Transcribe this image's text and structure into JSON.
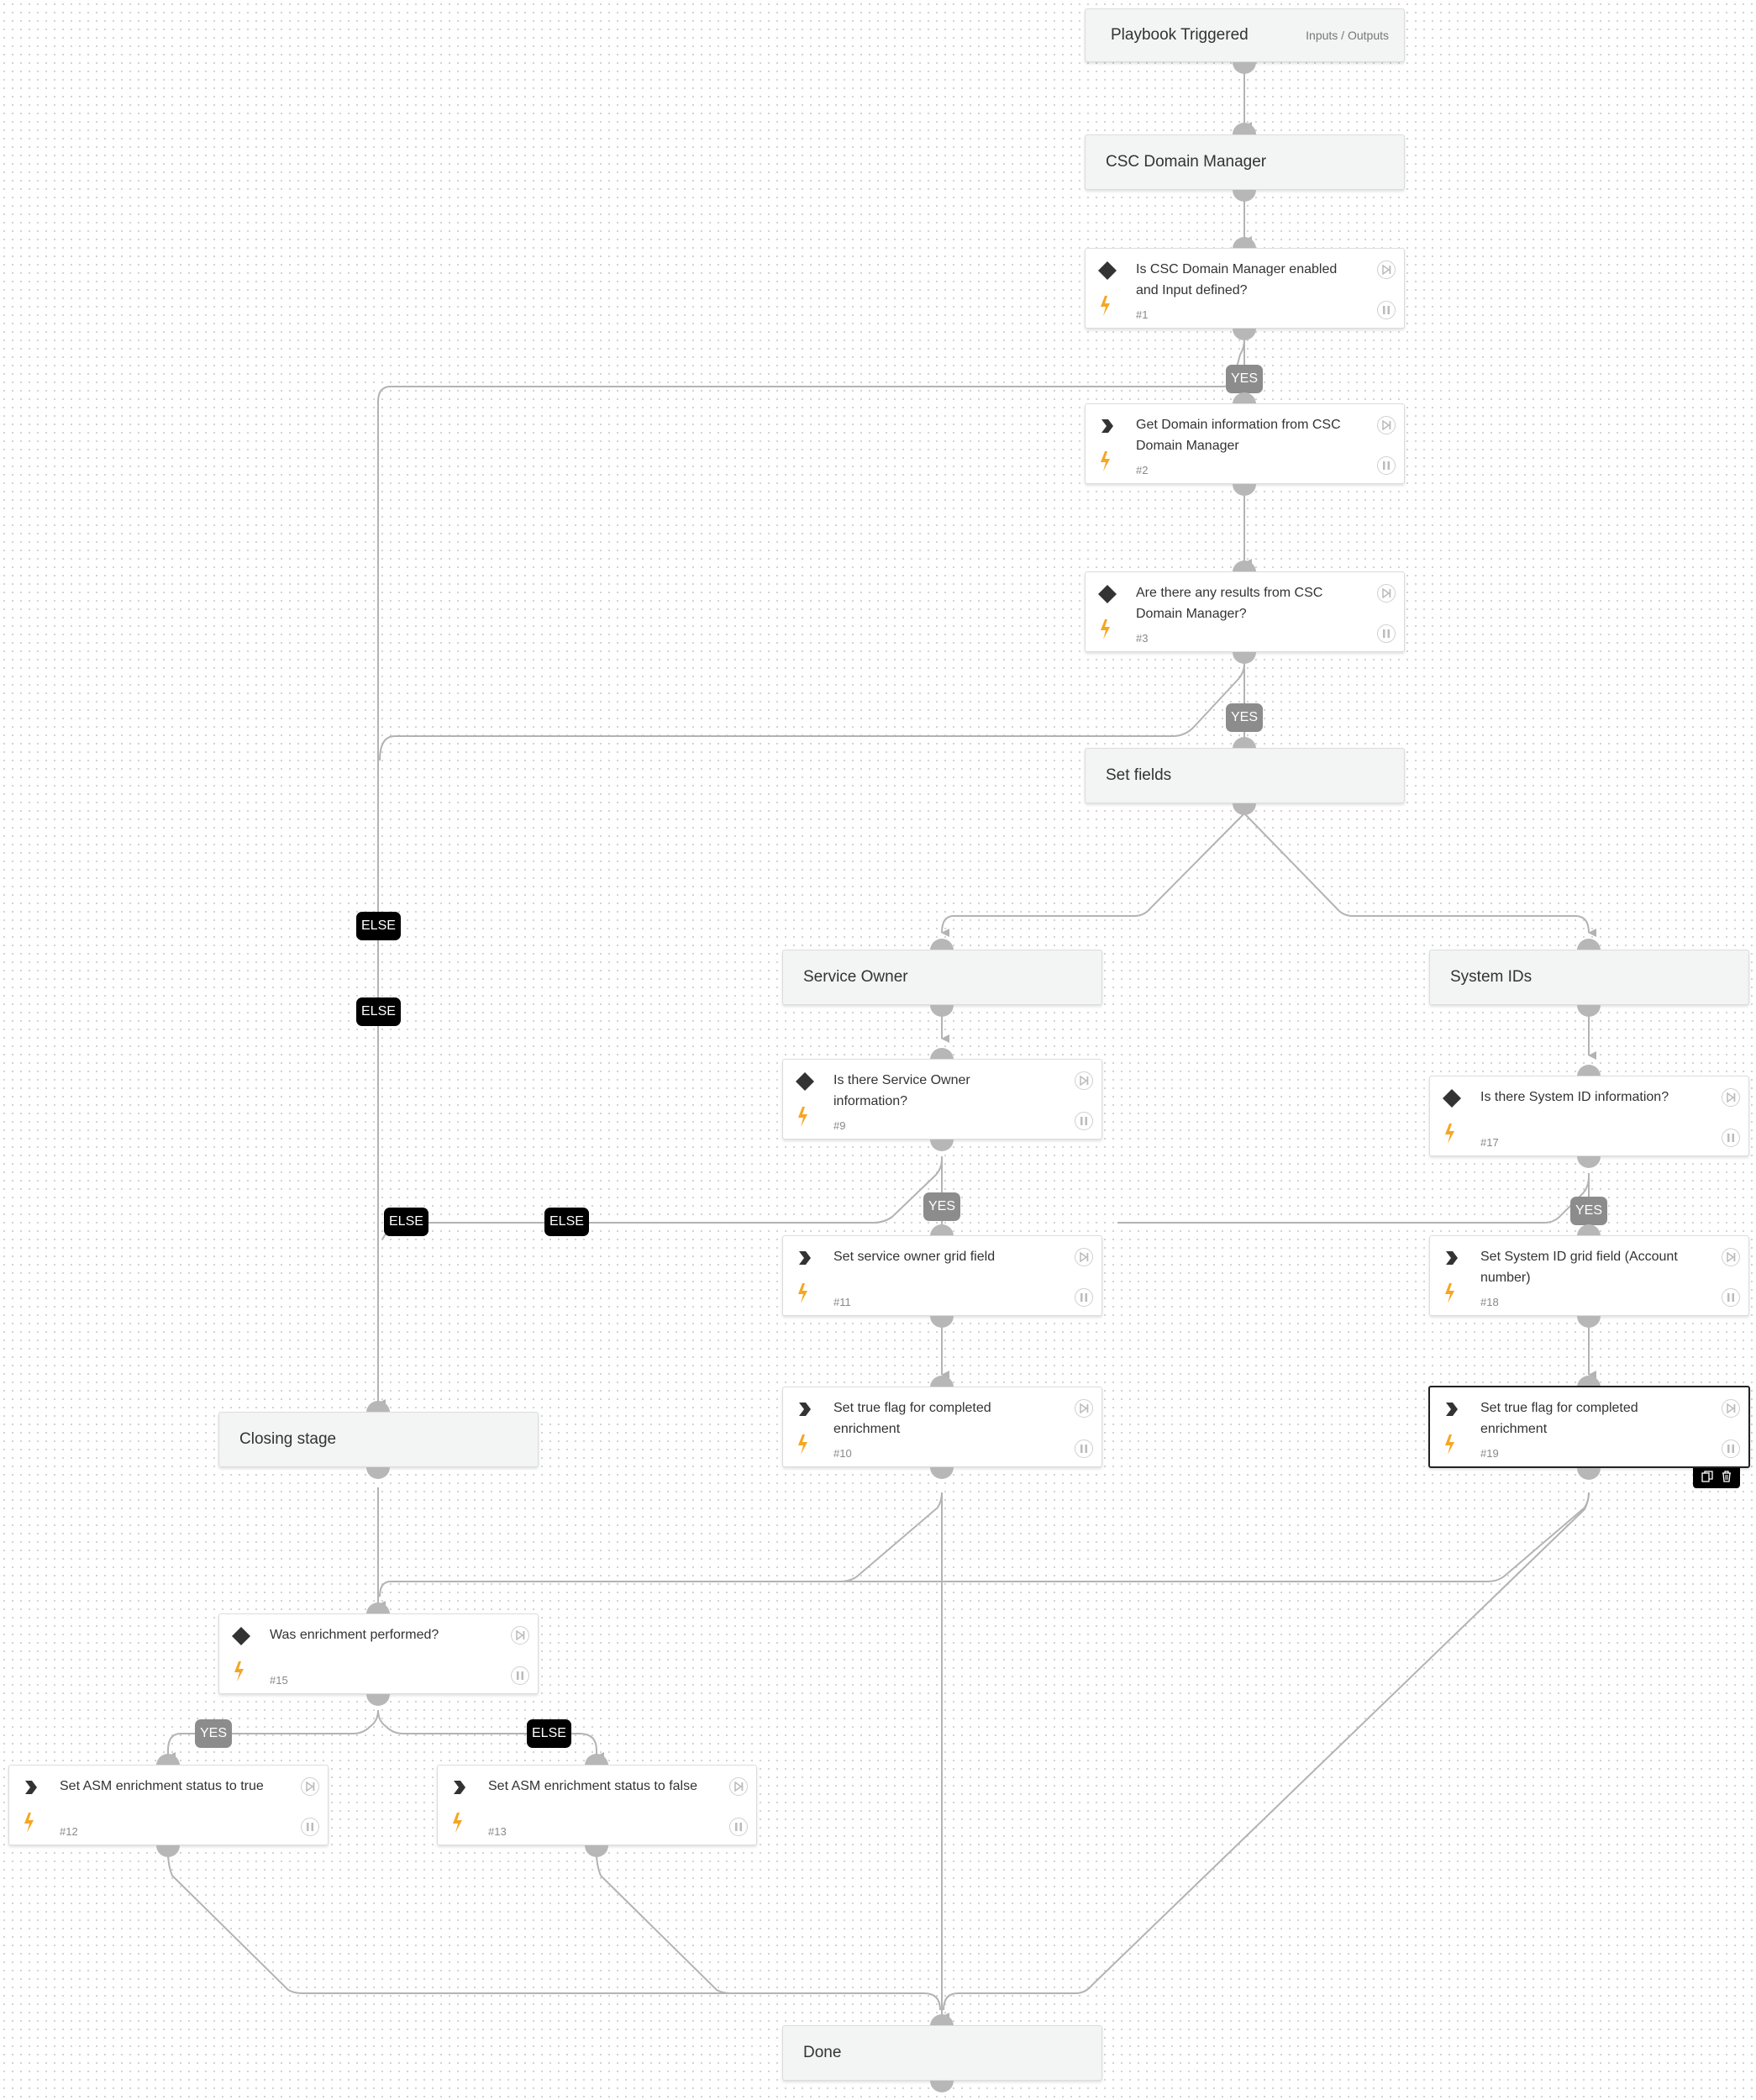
{
  "sections": {
    "playbook_triggered": {
      "title": "Playbook Triggered",
      "extra": "Inputs / Outputs"
    },
    "csc_domain_manager": {
      "title": "CSC Domain Manager"
    },
    "set_fields": {
      "title": "Set fields"
    },
    "service_owner": {
      "title": "Service Owner"
    },
    "system_ids": {
      "title": "System IDs"
    },
    "closing_stage": {
      "title": "Closing stage"
    },
    "done": {
      "title": "Done"
    }
  },
  "tasks": {
    "t1": {
      "type": "condition",
      "title": "Is CSC Domain Manager enabled and Input defined?",
      "id": "#1"
    },
    "t2": {
      "type": "action",
      "title": "Get Domain information from CSC Domain Manager",
      "id": "#2"
    },
    "t3": {
      "type": "condition",
      "title": "Are there any results from CSC Domain Manager?",
      "id": "#3"
    },
    "t9": {
      "type": "condition",
      "title": "Is there Service Owner information?",
      "id": "#9"
    },
    "t11": {
      "type": "action",
      "title": "Set service owner grid field",
      "id": "#11"
    },
    "t10": {
      "type": "action",
      "title": "Set true flag for completed enrichment",
      "id": "#10"
    },
    "t17": {
      "type": "condition",
      "title": "Is there System ID information?",
      "id": "#17"
    },
    "t18": {
      "type": "action",
      "title": "Set System ID grid field (Account number)",
      "id": "#18"
    },
    "t19": {
      "type": "action",
      "title": "Set true flag for completed enrichment",
      "id": "#19",
      "selected": true
    },
    "t15": {
      "type": "condition",
      "title": "Was enrichment performed?",
      "id": "#15"
    },
    "t12": {
      "type": "action",
      "title": "Set ASM enrichment status to true",
      "id": "#12"
    },
    "t13": {
      "type": "action",
      "title": "Set ASM enrichment status to false",
      "id": "#13"
    }
  },
  "badges": {
    "yes": "YES",
    "else": "ELSE"
  },
  "colors": {
    "edge": "#b3b3b3",
    "bolt": "#f5a623",
    "yes_badge": "#8c8c8c",
    "else_badge": "#000000"
  }
}
